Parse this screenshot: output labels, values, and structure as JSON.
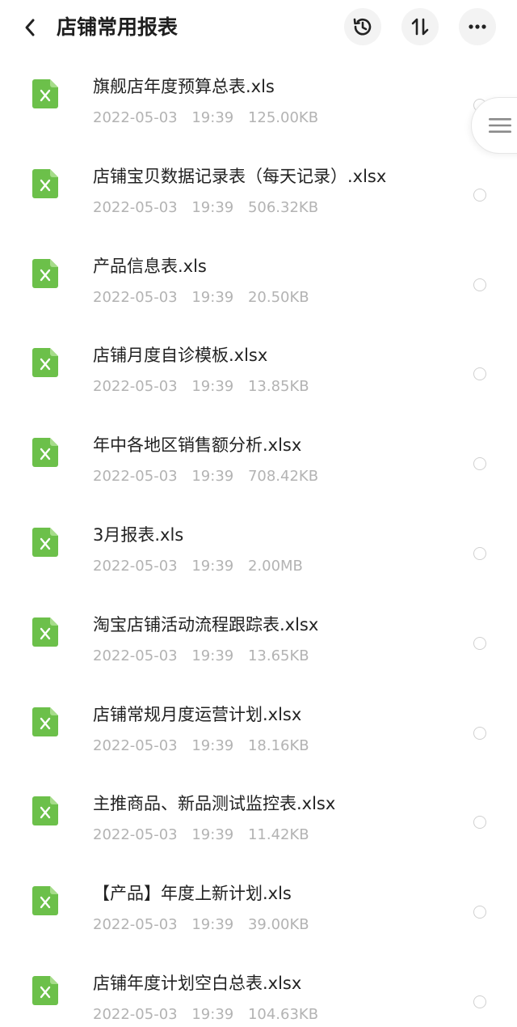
{
  "header": {
    "title": "店铺常用报表",
    "back_icon": "back-arrow-icon",
    "history_icon": "history-icon",
    "sort_icon": "sort-icon",
    "more_icon": "more-icon"
  },
  "colors": {
    "excel_green": "#6cc04a",
    "meta_gray": "#b3b3b3",
    "title_dark": "#1f1f1f"
  },
  "files": [
    {
      "name": "旗舰店年度预算总表.xls",
      "date": "2022-05-03",
      "time": "19:39",
      "size": "125.00KB"
    },
    {
      "name": "店铺宝贝数据记录表（每天记录）.xlsx",
      "date": "2022-05-03",
      "time": "19:39",
      "size": "506.32KB"
    },
    {
      "name": "产品信息表.xls",
      "date": "2022-05-03",
      "time": "19:39",
      "size": "20.50KB"
    },
    {
      "name": "店铺月度自诊模板.xlsx",
      "date": "2022-05-03",
      "time": "19:39",
      "size": "13.85KB"
    },
    {
      "name": "年中各地区销售额分析.xlsx",
      "date": "2022-05-03",
      "time": "19:39",
      "size": "708.42KB"
    },
    {
      "name": "3月报表.xls",
      "date": "2022-05-03",
      "time": "19:39",
      "size": "2.00MB"
    },
    {
      "name": "淘宝店铺活动流程跟踪表.xlsx",
      "date": "2022-05-03",
      "time": "19:39",
      "size": "13.65KB"
    },
    {
      "name": "店铺常规月度运营计划.xlsx",
      "date": "2022-05-03",
      "time": "19:39",
      "size": "18.16KB"
    },
    {
      "name": "主推商品、新品测试监控表.xlsx",
      "date": "2022-05-03",
      "time": "19:39",
      "size": "11.42KB"
    },
    {
      "name": "【产品】年度上新计划.xls",
      "date": "2022-05-03",
      "time": "19:39",
      "size": "39.00KB"
    },
    {
      "name": "店铺年度计划空白总表.xlsx",
      "date": "2022-05-03",
      "time": "19:39",
      "size": "104.63KB"
    }
  ],
  "side_handle": {
    "icon": "menu-lines-icon"
  }
}
